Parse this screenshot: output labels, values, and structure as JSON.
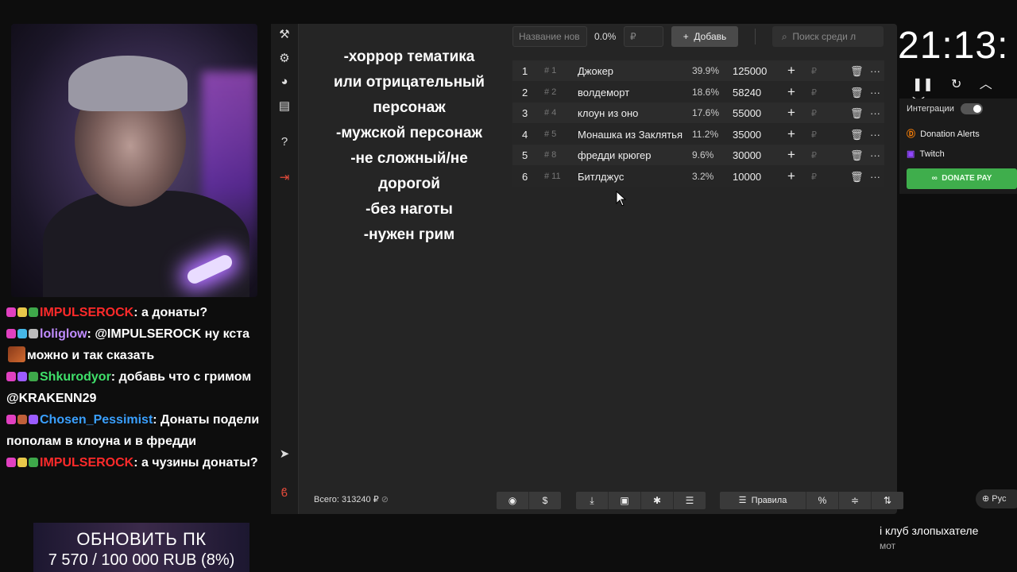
{
  "rules_text": [
    "-хоррор тематика",
    "или отрицательный",
    "персонаж",
    "-мужской персонаж",
    "-не сложный/не",
    "дорогой",
    "-без наготы",
    "-нужен грим"
  ],
  "toolbar": {
    "name_placeholder": "Название нов",
    "percent": "0.0%",
    "amount_placeholder": "₽",
    "add_label": "Добавь",
    "search_placeholder": "Поиск среди л"
  },
  "lots": [
    {
      "idx": "1",
      "hash": "# 1",
      "name": "Джокер",
      "pct": "39.9%",
      "amount": "125000"
    },
    {
      "idx": "2",
      "hash": "# 2",
      "name": "волдеморт",
      "pct": "18.6%",
      "amount": "58240"
    },
    {
      "idx": "3",
      "hash": "# 4",
      "name": "клоун из оно",
      "pct": "17.6%",
      "amount": "55000"
    },
    {
      "idx": "4",
      "hash": "# 5",
      "name": "Монашка из Заклятья",
      "pct": "11.2%",
      "amount": "35000"
    },
    {
      "idx": "5",
      "hash": "# 8",
      "name": "фредди крюгер",
      "pct": "9.6%",
      "amount": "30000"
    },
    {
      "idx": "6",
      "hash": "# 11",
      "name": "Битлджус",
      "pct": "3.2%",
      "amount": "10000"
    }
  ],
  "total": "Всего: 313240 ₽",
  "bottom": {
    "rules_label": "Правила",
    "percent_label": "%",
    "lang": "Рус"
  },
  "timer": "21:13:",
  "integrations": {
    "label": "Интеграции",
    "items": [
      "Donation Alerts",
      "Twitch"
    ],
    "donate_pay": "DONATE PAY"
  },
  "chat": [
    {
      "user": "IMPULSEROCK",
      "color": "#ff2a2a",
      "text": ": а донаты?"
    },
    {
      "user": "loliglow",
      "color": "#c08cff",
      "text": ": @IMPULSEROCK ну кста",
      "text2": "можно и так сказать"
    },
    {
      "user": "Shkurodyor",
      "color": "#3fe06a",
      "text": ": добавь что с гримом @KRAKENN29"
    },
    {
      "user": "Chosen_Pessimist",
      "color": "#3aa0ff",
      "text": ": Донаты подели пополам в клоуна и в фредди"
    },
    {
      "user": "IMPULSEROCK",
      "color": "#ff2a2a",
      "text": ": а чузины донаты?"
    }
  ],
  "goal": {
    "title": "ОБНОВИТЬ ПК",
    "progress": "7 570 / 100 000 RUB (8%)",
    "fraction": 0.08
  },
  "club": {
    "line1": "і клуб злопыхателе",
    "line2": "мот"
  }
}
